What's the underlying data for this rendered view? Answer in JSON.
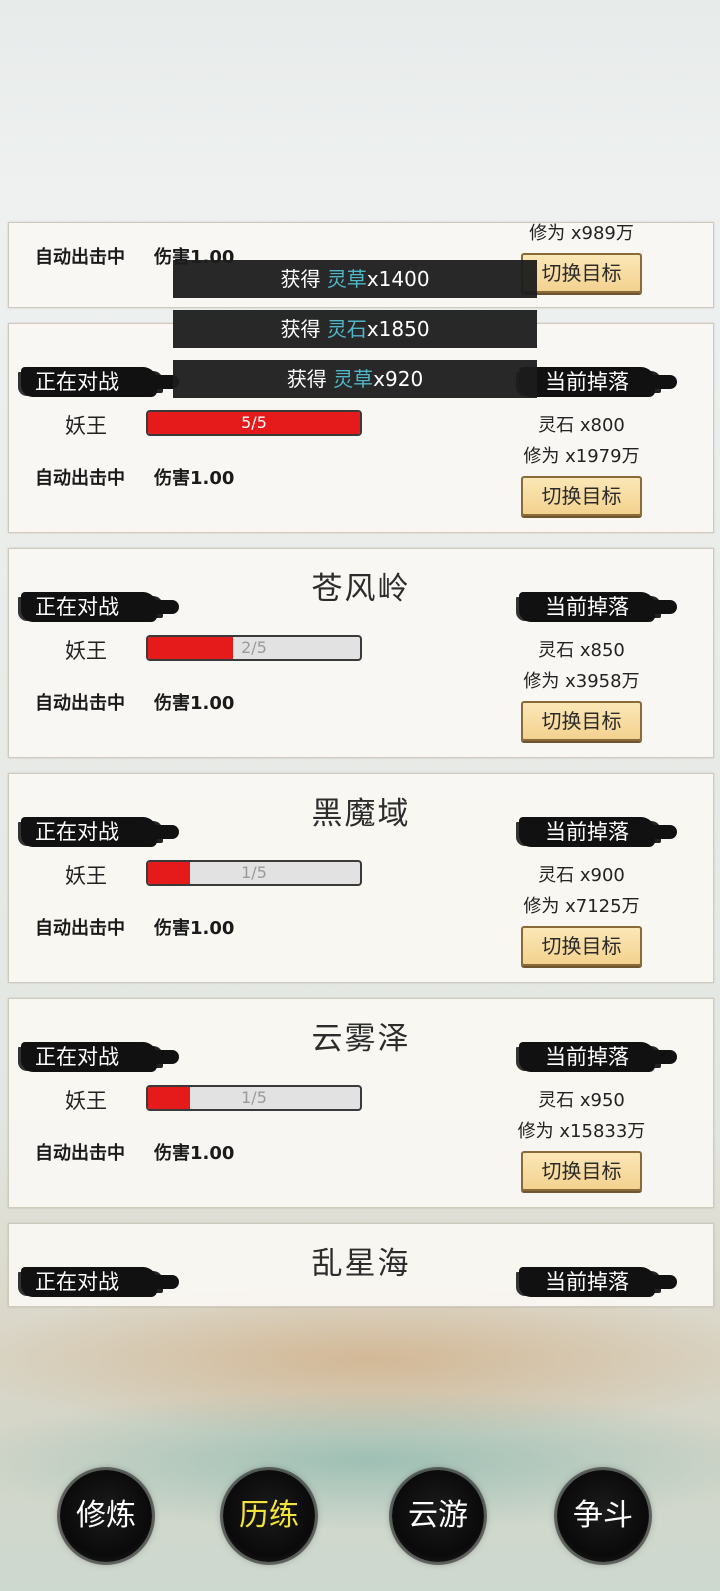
{
  "cards": [
    {
      "title": "",
      "auto_text": "自动出击中",
      "damage": "伤害1.00",
      "drop_xiuwei": "修为 x989万",
      "switch_label": "切换目标"
    },
    {
      "title": "",
      "battle_label": "正在对战",
      "drop_label": "当前掉落",
      "enemy": "妖王",
      "hp_text": "5/5",
      "hp_fraction": 1.0,
      "auto_text": "自动出击中",
      "damage": "伤害1.00",
      "drop_stone": "灵石 x800",
      "drop_xiuwei": "修为 x1979万",
      "switch_label": "切换目标"
    },
    {
      "title": "苍风岭",
      "battle_label": "正在对战",
      "drop_label": "当前掉落",
      "enemy": "妖王",
      "hp_text": "2/5",
      "hp_fraction": 0.4,
      "auto_text": "自动出击中",
      "damage": "伤害1.00",
      "drop_stone": "灵石 x850",
      "drop_xiuwei": "修为 x3958万",
      "switch_label": "切换目标"
    },
    {
      "title": "黑魔域",
      "battle_label": "正在对战",
      "drop_label": "当前掉落",
      "enemy": "妖王",
      "hp_text": "1/5",
      "hp_fraction": 0.2,
      "auto_text": "自动出击中",
      "damage": "伤害1.00",
      "drop_stone": "灵石 x900",
      "drop_xiuwei": "修为 x7125万",
      "switch_label": "切换目标"
    },
    {
      "title": "云雾泽",
      "battle_label": "正在对战",
      "drop_label": "当前掉落",
      "enemy": "妖王",
      "hp_text": "1/5",
      "hp_fraction": 0.2,
      "auto_text": "自动出击中",
      "damage": "伤害1.00",
      "drop_stone": "灵石 x950",
      "drop_xiuwei": "修为 x15833万",
      "switch_label": "切换目标"
    },
    {
      "title": "乱星海",
      "battle_label": "正在对战",
      "drop_label": "当前掉落"
    }
  ],
  "toasts": [
    {
      "prefix": "获得 ",
      "item": "灵草",
      "amount": "x1400"
    },
    {
      "prefix": "获得 ",
      "item": "灵石",
      "amount": "x1850"
    },
    {
      "prefix": "获得 ",
      "item": "灵草",
      "amount": "x920"
    }
  ],
  "nav": [
    {
      "label": "修炼",
      "active": false
    },
    {
      "label": "历练",
      "active": true
    },
    {
      "label": "云游",
      "active": false
    },
    {
      "label": "争斗",
      "active": false
    }
  ],
  "colors": {
    "hp_fill": "#e51a1a",
    "toast_item": "#4fb8c8",
    "nav_active": "#f2e33a",
    "button_bg": "#f3d28f"
  }
}
